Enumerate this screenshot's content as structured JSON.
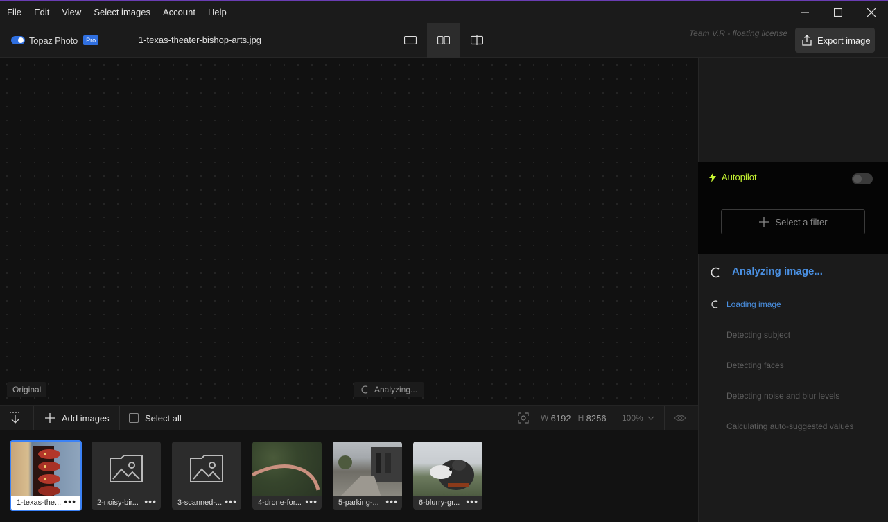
{
  "menu": [
    "File",
    "Edit",
    "View",
    "Select images",
    "Account",
    "Help"
  ],
  "header": {
    "app_name": "Topaz Photo",
    "badge": "Pro",
    "filename": "1-texas-theater-bishop-arts.jpg",
    "license": "Team V.R - floating license",
    "export_label": "Export image"
  },
  "canvas": {
    "label": "Original",
    "status": "Analyzing..."
  },
  "strip_toolbar": {
    "add_images": "Add images",
    "select_all": "Select all",
    "width_label": "W",
    "width_value": "6192",
    "height_label": "H",
    "height_value": "8256",
    "zoom": "100%"
  },
  "thumbnails": [
    {
      "caption": "1-texas-the...",
      "type": "photo"
    },
    {
      "caption": "2-noisy-bir...",
      "type": "placeholder"
    },
    {
      "caption": "3-scanned-...",
      "type": "placeholder"
    },
    {
      "caption": "4-drone-for...",
      "type": "photo"
    },
    {
      "caption": "5-parking-...",
      "type": "photo"
    },
    {
      "caption": "6-blurry-gr...",
      "type": "photo"
    }
  ],
  "right_panel": {
    "autopilot_label": "Autopilot",
    "select_filter": "Select a filter",
    "analyzing_title": "Analyzing image...",
    "steps": [
      "Loading image",
      "Detecting subject",
      "Detecting faces",
      "Detecting noise and blur levels",
      "Calculating auto-suggested values"
    ]
  },
  "colors": {
    "accent": "#4a90e2",
    "autopilot": "#c6f432",
    "selection": "#3b82f6",
    "title_border": "#6a3db3"
  }
}
